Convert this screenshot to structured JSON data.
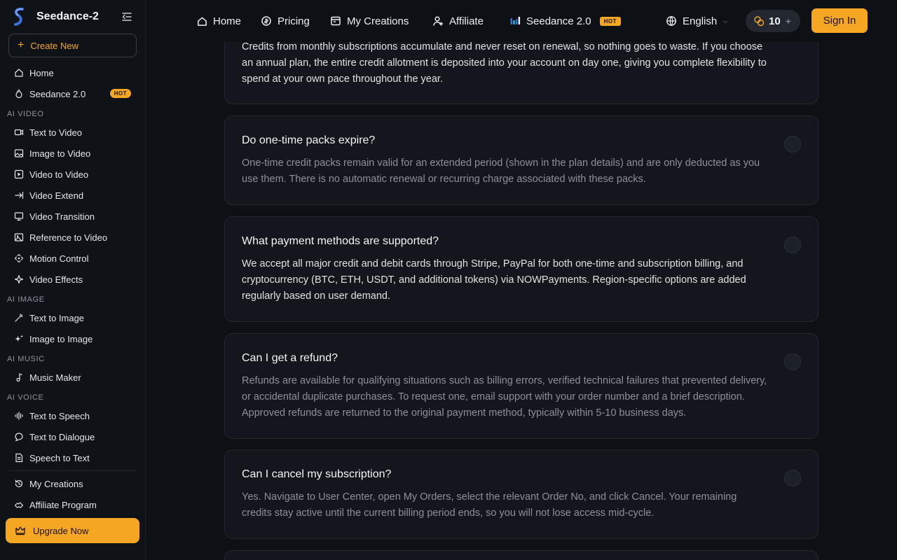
{
  "brand": {
    "name": "Seedance-2"
  },
  "sidebar": {
    "create_label": "Create New",
    "top_items": [
      {
        "label": "Home"
      },
      {
        "label": "Seedance 2.0",
        "badge": "HOT"
      }
    ],
    "sections": [
      {
        "title": "AI VIDEO",
        "items": [
          "Text to Video",
          "Image to Video",
          "Video to Video",
          "Video Extend",
          "Video Transition",
          "Reference to Video",
          "Motion Control",
          "Video Effects"
        ]
      },
      {
        "title": "AI IMAGE",
        "items": [
          "Text to Image",
          "Image to Image"
        ]
      },
      {
        "title": "AI MUSIC",
        "items": [
          "Music Maker"
        ]
      },
      {
        "title": "AI VOICE",
        "items": [
          "Text to Speech",
          "Text to Dialogue",
          "Speech to Text"
        ]
      }
    ],
    "bottom_items": [
      "My Creations",
      "Affiliate Program"
    ],
    "upgrade_label": "Upgrade Now"
  },
  "topnav": {
    "items": [
      "Home",
      "Pricing",
      "My Creations",
      "Affiliate",
      "Seedance 2.0"
    ],
    "hot_badge": "HOT",
    "language": "English",
    "credits": "10",
    "signin": "Sign In"
  },
  "faq": [
    {
      "question": "",
      "answer": "Credits from monthly subscriptions accumulate and never reset on renewal, so nothing goes to waste. If you choose an annual plan, the entire credit allotment is deposited into your account on day one, giving you complete flexibility to spend at your own pace throughout the year.",
      "expanded": true
    },
    {
      "question": "Do one-time packs expire?",
      "answer": "One-time credit packs remain valid for an extended period (shown in the plan details) and are only deducted as you use them. There is no automatic renewal or recurring charge associated with these packs.",
      "expanded": false
    },
    {
      "question": "What payment methods are supported?",
      "answer": "We accept all major credit and debit cards through Stripe, PayPal for both one-time and subscription billing, and cryptocurrency (BTC, ETH, USDT, and additional tokens) via NOWPayments. Region-specific options are added regularly based on user demand.",
      "expanded": true
    },
    {
      "question": "Can I get a refund?",
      "answer": "Refunds are available for qualifying situations such as billing errors, verified technical failures that prevented delivery, or accidental duplicate purchases. To request one, email support with your order number and a brief description. Approved refunds are returned to the original payment method, typically within 5-10 business days.",
      "expanded": false
    },
    {
      "question": "Can I cancel my subscription?",
      "answer": "Yes. Navigate to User Center, open My Orders, select the relevant Order No, and click Cancel. Your remaining credits stay active until the current billing period ends, so you will not lose access mid-cycle.",
      "expanded": false
    }
  ],
  "colors": {
    "accent": "#f5a623",
    "background": "#0d1015",
    "card": "#13161c"
  }
}
